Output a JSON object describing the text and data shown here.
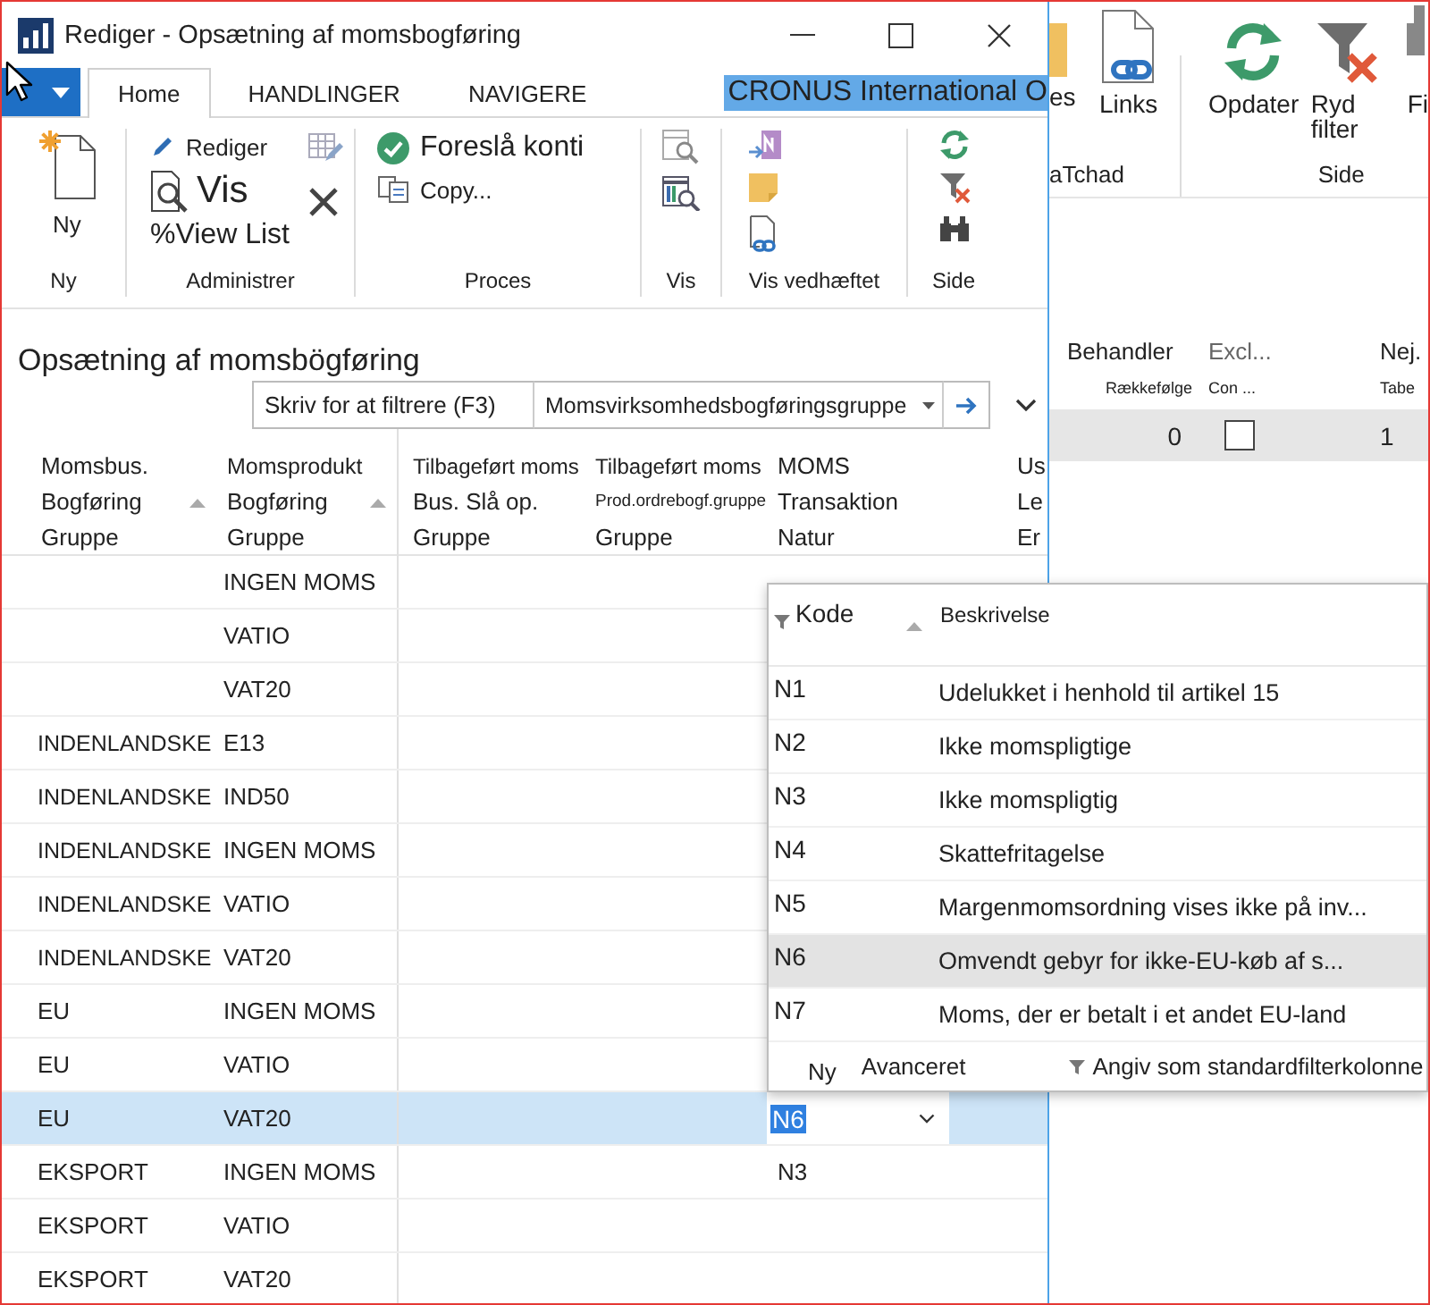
{
  "front_window": {
    "title": "Rediger - Opsætning af momsbogføring",
    "tabs": [
      {
        "label": "Home",
        "selected": true
      },
      {
        "label": "HANDLINGER",
        "selected": false
      },
      {
        "label": "NAVIGERE",
        "selected": false
      }
    ],
    "company": "CRONUS International O",
    "ribbon_groups": [
      {
        "label": "Ny",
        "items": [
          "Ny"
        ]
      },
      {
        "label": "Administrer",
        "items": [
          "Rediger",
          "Vis",
          "%View List"
        ]
      },
      {
        "label": "Proces",
        "items": [
          "Foreslå konti",
          "Copy..."
        ]
      },
      {
        "label": "Vis"
      },
      {
        "label": "Vis vedhæftet"
      },
      {
        "label": "Side"
      }
    ],
    "page_title": "Opsætning af momsbögføring",
    "filter": {
      "placeholder": "Skriv for at filtrere (F3)",
      "field": "Momsvirksomhedsbogføringsgruppe"
    },
    "table": {
      "columns": [
        {
          "lines": [
            "Momsbus.",
            "Bogføring",
            "Gruppe"
          ],
          "sorted": true
        },
        {
          "lines": [
            "Momsprodukt",
            "Bogføring",
            "Gruppe"
          ],
          "sorted": true
        },
        {
          "lines": [
            "Tilbageført moms",
            "Bus. Slå op.",
            "Gruppe"
          ],
          "sorted": false
        },
        {
          "lines": [
            "Tilbageført moms",
            "Prod.ordrebogf.gruppe",
            "Gruppe"
          ],
          "sorted": false
        },
        {
          "lines": [
            "MOMS",
            "Transaktion",
            "Natur"
          ],
          "sorted": false
        },
        {
          "lines": [
            "Us",
            "Le",
            "Er"
          ],
          "sorted": false
        }
      ],
      "rows": [
        {
          "prod": "INGEN MOMS",
          "selected": false
        },
        {
          "prod": "VATIO",
          "selected": false
        },
        {
          "prod": "VAT20",
          "selected": false
        },
        {
          "bus": "INDENLANDSKE",
          "prod": "E13",
          "selected": false
        },
        {
          "bus": "INDENLANDSKE",
          "prod": "IND50",
          "selected": false
        },
        {
          "bus": "INDENLANDSKE",
          "prod": "INGEN MOMS",
          "selected": false
        },
        {
          "bus": "INDENLANDSKE",
          "prod": "VATIO",
          "selected": false
        },
        {
          "bus": "INDENLANDSKE",
          "prod": "VAT20",
          "selected": false
        },
        {
          "bus": "EU",
          "prod": "INGEN MOMS",
          "selected": false
        },
        {
          "bus": "EU",
          "prod": "VATIO",
          "selected": false
        },
        {
          "bus": "EU",
          "prod": "VAT20",
          "nature": "N6",
          "selected": true
        },
        {
          "bus": "EKSPORT",
          "prod": "INGEN MOMS",
          "nature": "N3",
          "selected": false
        },
        {
          "bus": "EKSPORT",
          "prod": "VATIO",
          "selected": false
        },
        {
          "bus": "EKSPORT",
          "prod": "VAT20",
          "selected": false
        }
      ]
    },
    "lookup": {
      "columns": [
        "Kode",
        "Beskrivelse"
      ],
      "rows": [
        {
          "code": "N1",
          "description": "Udelukket i henhold til artikel 15",
          "selected": false
        },
        {
          "code": "N2",
          "description": "Ikke momspligtige",
          "selected": false
        },
        {
          "code": "N3",
          "description": "Ikke momspligtig",
          "selected": false
        },
        {
          "code": "N4",
          "description": "Skattefritagelse",
          "selected": false
        },
        {
          "code": "N5",
          "description": "Margenmomsordning vises ikke på inv...",
          "selected": false
        },
        {
          "code": "N6",
          "description": "Omvendt gebyr for ikke-EU-køb af s...",
          "selected": true
        },
        {
          "code": "N7",
          "description": "Moms, der er betalt i et andet EU-land",
          "selected": false
        }
      ],
      "footer": [
        "Ny",
        "Avanceret",
        "Angiv som standardfilterkolonne"
      ]
    }
  },
  "back_window": {
    "ribbon_groups": [
      {
        "label": "aTchad",
        "items": [
          "es",
          "Links"
        ]
      },
      {
        "label": "Side",
        "items": [
          "Opdater",
          "Ryd filter",
          "Fi"
        ]
      }
    ],
    "columns": [
      {
        "lines": [
          "Behandler",
          "Rækkefølge"
        ]
      },
      {
        "lines": [
          "Excl...",
          "Con ..."
        ]
      },
      {
        "lines": [
          "Nej.",
          "Tabe"
        ]
      }
    ],
    "rows": [
      {
        "value": "0",
        "checked": false,
        "value_3": "1",
        "selected": true
      }
    ]
  }
}
